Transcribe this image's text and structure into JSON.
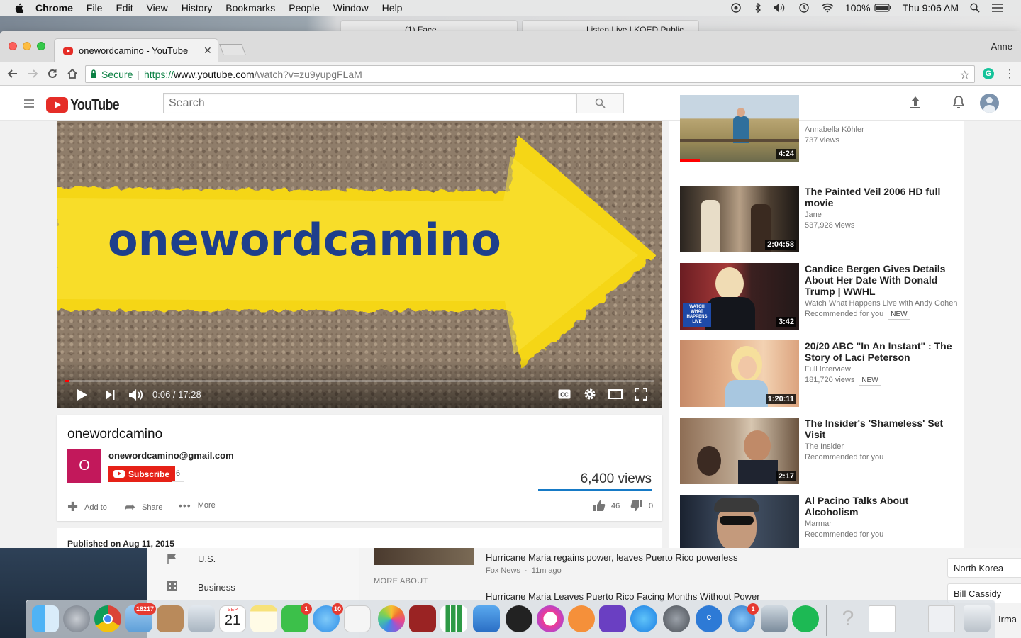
{
  "menubar": {
    "app": "Chrome",
    "items": [
      "File",
      "Edit",
      "View",
      "History",
      "Bookmarks",
      "People",
      "Window",
      "Help"
    ],
    "battery": "100%",
    "clock": "Thu 9:06 AM"
  },
  "bg_tabs": [
    "(1) Face",
    "Listen Live | KQED Public"
  ],
  "browser": {
    "tab_title": "onewordcamino - YouTube",
    "profile": "Anne",
    "secure_label": "Secure",
    "url_scheme": "https://",
    "url_host": "www.youtube.com",
    "url_path": "/watch?v=zu9yupgFLaM"
  },
  "youtube": {
    "logo": "YouTube",
    "search_placeholder": "Search"
  },
  "player": {
    "overlay_text": "onewordcamino",
    "time": "0:06 / 17:28",
    "progress": 0.006
  },
  "video": {
    "title": "onewordcamino",
    "channel_initial": "O",
    "channel_name": "onewordcamino@gmail.com",
    "subscribe_label": "Subscribe",
    "subscriber_count": "6",
    "views": "6,400 views",
    "actions": {
      "add_to": "Add to",
      "share": "Share",
      "more": "More"
    },
    "likes": "46",
    "dislikes": "0",
    "published": "Published on Aug 11, 2015"
  },
  "sidebar": {
    "items": [
      {
        "title": "",
        "channel": "Annabella Köhler",
        "meta": "737 views",
        "duration": "4:24"
      },
      {
        "title": "The Painted Veil 2006 HD full movie",
        "channel": "Jane",
        "meta": "537,928 views",
        "duration": "2:04:58"
      },
      {
        "title": "Candice Bergen Gives Details About Her Date With Donald Trump | WWHL",
        "channel": "Watch What Happens Live with Andy Cohen",
        "meta": "Recommended for you",
        "badge": "NEW",
        "duration": "3:42",
        "thumb_text": "WATCH WHAT HAPPENS LIVE"
      },
      {
        "title": "20/20 ABC \"In An Instant\" : The Story of Laci Peterson",
        "channel": "Full Interview",
        "meta": "181,720 views",
        "badge": "NEW",
        "duration": "1:20:11"
      },
      {
        "title": "The Insider's 'Shameless' Set Visit",
        "channel": "The Insider",
        "meta": "Recommended for you",
        "duration": "2:17"
      },
      {
        "title": "Al Pacino Talks About Alcoholism",
        "channel": "Marmar",
        "meta": "Recommended for you",
        "duration": ""
      }
    ]
  },
  "lower": {
    "nav": [
      "U.S.",
      "Business"
    ],
    "headline1": "Hurricane Maria regains power, leaves Puerto Rico powerless",
    "source1": "Fox News",
    "time1": "11m ago",
    "more_about": "MORE ABOUT",
    "headline2": "Hurricane Maria Leaves Puerto Rico Facing Months Without Power",
    "chips": [
      "North Korea",
      "Bill Cassidy"
    ],
    "partial": "Irma"
  },
  "dock": {
    "calendar_month": "SEP",
    "calendar_day": "21",
    "mail_badge": "18217",
    "facetime_badge": "1",
    "messages_badge": "10",
    "other_badge": "1"
  },
  "colors": {
    "youtube_red": "#e52d27",
    "subscribe_red": "#e62117",
    "link_blue": "#167ac6",
    "secure_green": "#0b8043"
  }
}
